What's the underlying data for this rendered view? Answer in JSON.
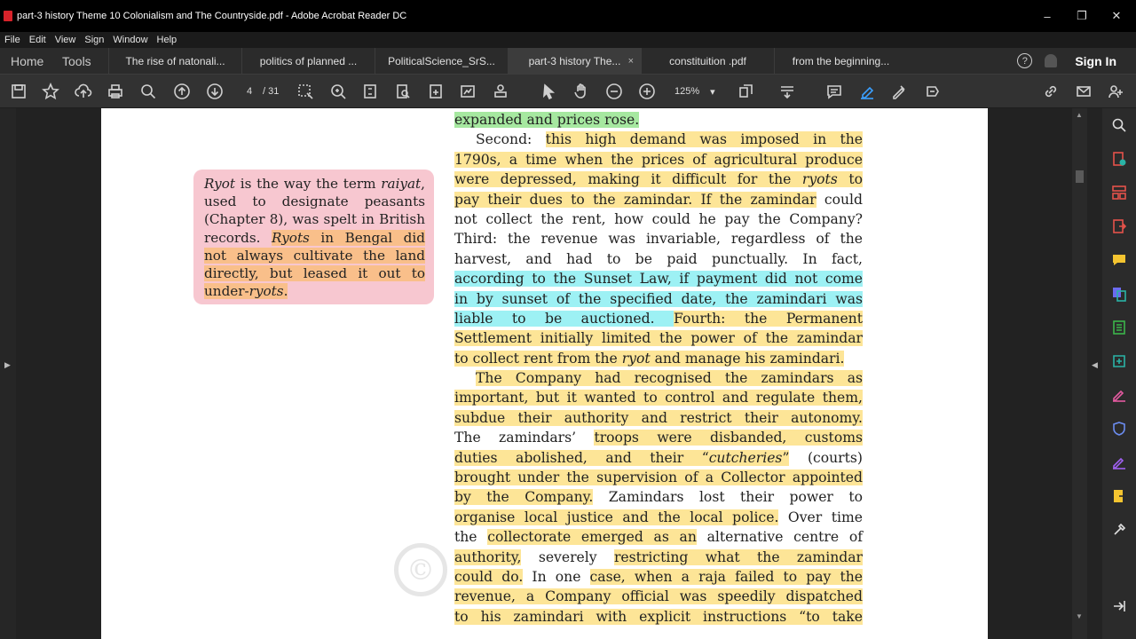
{
  "window": {
    "title": "part-3 history Theme 10 Colonialism and The Countryside.pdf - Adobe Acrobat Reader DC",
    "controls": [
      "–",
      "❐",
      "✕"
    ]
  },
  "menu": [
    "File",
    "Edit",
    "View",
    "Sign",
    "Window",
    "Help"
  ],
  "nav": {
    "home": "Home",
    "tools": "Tools",
    "signin": "Sign In",
    "help_icon": "?"
  },
  "tabs": [
    {
      "label": "The rise of natonali...",
      "active": false
    },
    {
      "label": "politics of planned ...",
      "active": false
    },
    {
      "label": "PoliticalScience_SrS...",
      "active": false
    },
    {
      "label": "part-3 history The...",
      "active": true
    },
    {
      "label": "constituition .pdf",
      "active": false
    },
    {
      "label": "from the beginning...",
      "active": false
    }
  ],
  "tab_close": "×",
  "toolbar": {
    "page_current": "4",
    "page_total": "/ 31",
    "zoom": "125%",
    "zoom_caret": "▾"
  },
  "sidebox": {
    "lines": [
      [
        {
          "t": "Ryot",
          "i": true
        },
        {
          "t": " is the way the term "
        },
        {
          "t": "raiyat",
          "i": true
        },
        {
          "t": ","
        }
      ],
      [
        {
          "t": "used to designate peasants"
        }
      ],
      [
        {
          "t": "(Chapter 8), was spelt in British"
        }
      ],
      [
        {
          "t": "records. "
        },
        {
          "t": "Ryots",
          "i": true,
          "h": "o"
        },
        {
          "t": " in Bengal did",
          "h": "o"
        }
      ],
      [
        {
          "t": "not always cultivate the land",
          "h": "o"
        }
      ],
      [
        {
          "t": "directly, but leased it out to",
          "h": "o"
        }
      ],
      [
        {
          "t": "under-",
          "h": "o"
        },
        {
          "t": "ryots",
          "i": true,
          "h": "o"
        },
        {
          "t": ".",
          "h": "o"
        }
      ]
    ]
  },
  "body_lines": [
    [
      {
        "t": "expanded and prices rose.",
        "h": "g"
      }
    ],
    [
      {
        "t": "Second: "
      },
      {
        "t": "this high demand was imposed in the",
        "h": "y"
      }
    ],
    [
      {
        "t": "1790s, a time when the prices of agricultural produce",
        "h": "y"
      }
    ],
    [
      {
        "t": "were depressed, making it difficult for the ",
        "h": "y"
      },
      {
        "t": "ryots",
        "i": true,
        "h": "y"
      },
      {
        "t": " to",
        "h": "y"
      }
    ],
    [
      {
        "t": "pay their dues to the zamindar. If the zamindar",
        "h": "y"
      },
      {
        "t": " could"
      }
    ],
    [
      {
        "t": "not collect the rent, how could he pay the Company?"
      }
    ],
    [
      {
        "t": "Third: the revenue was invariable, regardless of the"
      }
    ],
    [
      {
        "t": "harvest, and had to be paid punctually. In fact,"
      }
    ],
    [
      {
        "t": "according to the Sunset Law, if payment did not come",
        "h": "c"
      }
    ],
    [
      {
        "t": "in by sunset of the specified date, the zamindari was",
        "h": "c"
      }
    ],
    [
      {
        "t": "liable to be auctioned. ",
        "h": "c"
      },
      {
        "t": "Fourth: the Permanent",
        "h": "y"
      }
    ],
    [
      {
        "t": "Settlement initially limited the power of the zamindar",
        "h": "y"
      }
    ],
    [
      {
        "t": "to collect rent from the ",
        "h": "y"
      },
      {
        "t": "ryot",
        "i": true,
        "h": "y"
      },
      {
        "t": " and manage his zamindari.",
        "h": "y"
      }
    ],
    [
      {
        "t": "The Company had recognised the zamindars as",
        "h": "y"
      }
    ],
    [
      {
        "t": "important, but it wanted to control and regulate them,",
        "h": "y"
      }
    ],
    [
      {
        "t": "subdue their authority and restrict their autonomy.",
        "h": "y"
      }
    ],
    [
      {
        "t": "The zamindars’ "
      },
      {
        "t": "troops were disbanded, customs",
        "h": "y"
      }
    ],
    [
      {
        "t": "duties abolished, and their “",
        "h": "y"
      },
      {
        "t": "cutcheries",
        "i": true,
        "h": "y"
      },
      {
        "t": "”",
        "h": "y"
      },
      {
        "t": " (courts)"
      }
    ],
    [
      {
        "t": "brought under the supervision of a Collector appointed",
        "h": "y"
      }
    ],
    [
      {
        "t": "by the Company.",
        "h": "y"
      },
      {
        "t": " Zamindars lost their power to"
      }
    ],
    [
      {
        "t": "organise local justice and the local police.",
        "h": "y"
      },
      {
        "t": " Over time"
      }
    ],
    [
      {
        "t": "the "
      },
      {
        "t": "collectorate emerged as an",
        "h": "y"
      },
      {
        "t": " alternative centre of"
      }
    ],
    [
      {
        "t": "authority,",
        "h": "y"
      },
      {
        "t": " severely "
      },
      {
        "t": "restricting what the zamindar",
        "h": "y"
      }
    ],
    [
      {
        "t": "could do.",
        "h": "y"
      },
      {
        "t": " In one "
      },
      {
        "t": "case, when a raja failed to pay the",
        "h": "y"
      }
    ],
    [
      {
        "t": "revenue, a Company official was speedily dispatched",
        "h": "y"
      }
    ],
    [
      {
        "t": "to his zamindari with explicit instructions “to take",
        "h": "y"
      }
    ]
  ],
  "watermark": "©"
}
